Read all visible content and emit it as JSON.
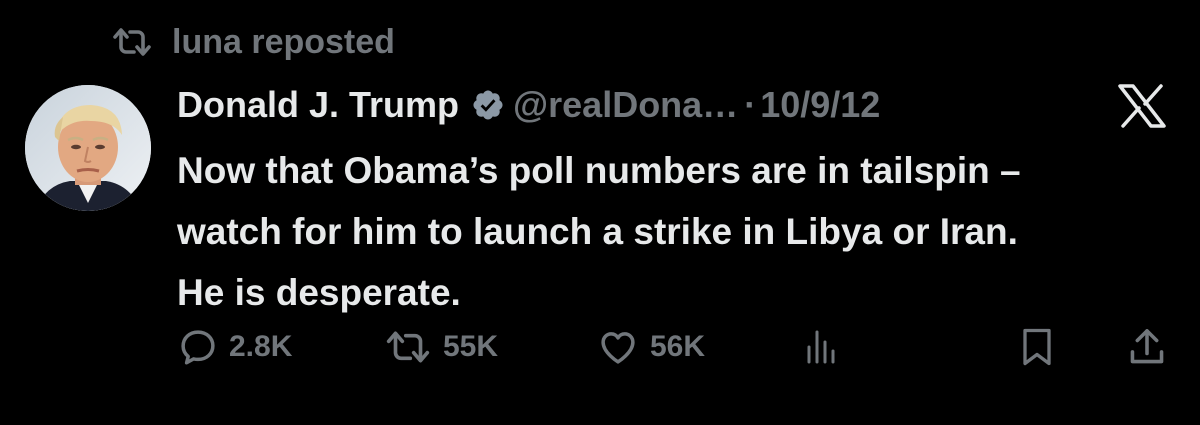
{
  "repost": {
    "text": "luna reposted",
    "icon": "repost-icon"
  },
  "author": {
    "name": "Donald J. Trump",
    "handle": "@realDona…",
    "separator": "·",
    "date": "10/9/12",
    "verified_icon": "verified-badge-icon"
  },
  "platform_icon": "x-logo-icon",
  "tweet": {
    "lines": [
      "Now that Obama’s poll numbers are in tailspin –",
      "watch for him to launch a strike in Libya or Iran.",
      "He is desperate."
    ]
  },
  "actions": {
    "replies": "2.8K",
    "reposts": "55K",
    "likes": "56K"
  },
  "colors": {
    "background": "#000000",
    "text": "#e7e9ea",
    "muted": "#71767b"
  }
}
